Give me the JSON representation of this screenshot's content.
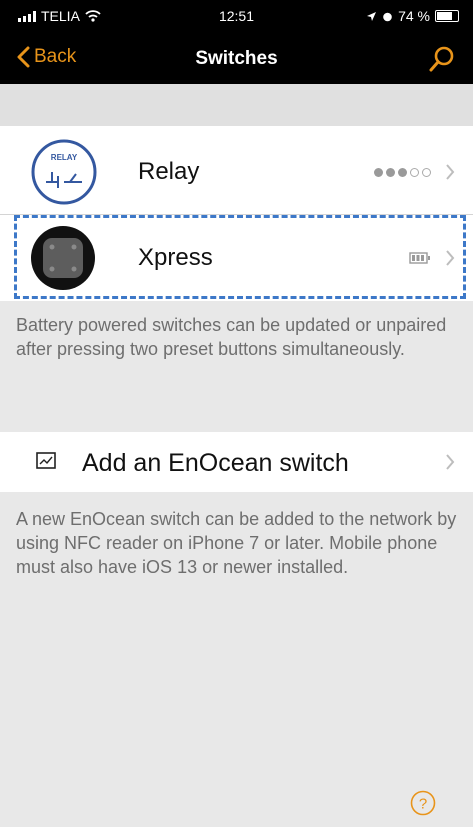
{
  "status_bar": {
    "carrier": "TELIA",
    "time": "12:51",
    "battery_percent": "74 %"
  },
  "nav": {
    "back_label": "Back",
    "title": "Switches",
    "search_icon": "search-icon",
    "accent_color": "#e8941a"
  },
  "switches": [
    {
      "name": "Relay",
      "icon": "relay-icon",
      "indicator": "signal-dots",
      "signal_level": 3,
      "signal_max": 5
    },
    {
      "name": "Xpress",
      "icon": "xpress-switch-icon",
      "indicator": "battery-icon"
    }
  ],
  "battery_note": "Battery powered switches can be updated or unpaired after pressing two preset buttons simultaneously.",
  "add_switch": {
    "label": "Add an EnOcean switch",
    "icon": "nfc-tag-icon"
  },
  "add_note": "A new EnOcean switch can be added to the network by using NFC reader on iPhone 7 or later. Mobile phone must also have iOS 13 or newer installed.",
  "highlight_color": "#3d78c8"
}
